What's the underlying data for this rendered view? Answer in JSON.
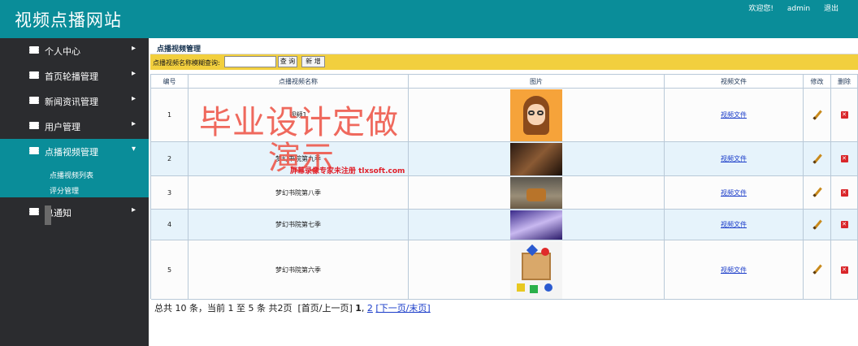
{
  "header": {
    "site_title": "视频点播网站",
    "welcome": "欢迎您!",
    "user": "admin",
    "logout": "退出",
    "color": "#0a8d99"
  },
  "sidebar": {
    "items": [
      {
        "label": "个人中心",
        "arrow": "▸"
      },
      {
        "label": "首页轮播管理",
        "arrow": "▸"
      },
      {
        "label": "新闻资讯管理",
        "arrow": "▸"
      },
      {
        "label": "用户管理",
        "arrow": "▸"
      },
      {
        "label": "点播视频管理",
        "arrow": "▾"
      },
      {
        "label": "息通知",
        "arrow": "▸"
      }
    ],
    "sub_items": [
      "点播视频列表",
      "评分管理"
    ]
  },
  "main": {
    "title": "点播视频管理",
    "search_label": "点播视频名称模糊查询:",
    "search_value": "",
    "search_button": "查 询",
    "add_button": "新 增",
    "columns": [
      "编号",
      "点播视频名称",
      "图片",
      "视频文件",
      "修改",
      "删除"
    ],
    "rows": [
      {
        "id": "1",
        "name": "视频1",
        "file": "视频文件"
      },
      {
        "id": "2",
        "name": "梦幻书院第九季",
        "file": "视频文件"
      },
      {
        "id": "3",
        "name": "梦幻书院第八季",
        "file": "视频文件"
      },
      {
        "id": "4",
        "name": "梦幻书院第七季",
        "file": "视频文件"
      },
      {
        "id": "5",
        "name": "梦幻书院第六季",
        "file": "视频文件"
      }
    ],
    "pager": {
      "summary": "总共 10 条，当前 1 至 5 条 共2页",
      "first_prev": "[首页/上一页]",
      "page1": "1",
      "page2": "2",
      "next_last": "[下一页/末页]"
    }
  },
  "overlay": {
    "watermark_line1": "毕业设计定做",
    "watermark_line2": "演示",
    "recorder_note": "屏幕录像专家未注册 tlxsoft.com"
  }
}
